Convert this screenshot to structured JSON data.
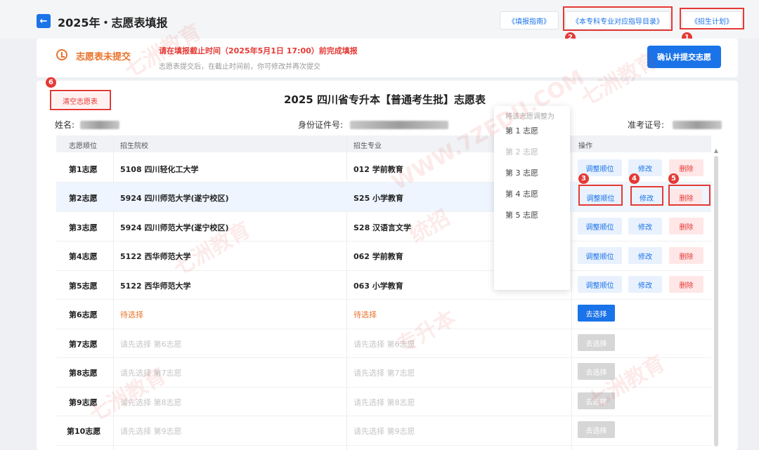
{
  "header": {
    "back_icon": "arrow-left-icon",
    "title": "2025年・志愿表填报",
    "links": [
      "《填报指南》",
      "《本专科专业对应指导目录》",
      "《招生计划》"
    ]
  },
  "notice": {
    "status_icon": "clock-icon",
    "status": "志愿表未提交",
    "deadline": "请在填报截止时间（2025年5月1日 17:00）前完成填报",
    "sub": "志愿表提交后，在截止时间前，你可修改并再次提交",
    "submit_label": "确认并提交志愿"
  },
  "panel": {
    "clear_label": "清空志愿表",
    "title": "2025 四川省专升本【普通考生批】志愿表",
    "name_label": "姓名:",
    "id_label": "身份证件号:",
    "ticket_label": "准考证号:"
  },
  "table": {
    "headers": [
      "志愿顺位",
      "招生院校",
      "招生专业",
      "操作"
    ],
    "rows": [
      {
        "rank": "第1志愿",
        "school": "5108 四川轻化工大学",
        "major": "012 学前教育"
      },
      {
        "rank": "第2志愿",
        "school": "5924 四川师范大学(遂宁校区)",
        "major": "S25 小学教育"
      },
      {
        "rank": "第3志愿",
        "school": "5924 四川师范大学(遂宁校区)",
        "major": "S28 汉语言文学"
      },
      {
        "rank": "第4志愿",
        "school": "5122 西华师范大学",
        "major": "062 学前教育"
      },
      {
        "rank": "第5志愿",
        "school": "5122 西华师范大学",
        "major": "063 小学教育"
      },
      {
        "rank": "第6志愿",
        "school": "待选择",
        "major": "待选择"
      },
      {
        "rank": "第7志愿",
        "school": "请先选择 第6志愿",
        "major": "请先选择 第6志愿"
      },
      {
        "rank": "第8志愿",
        "school": "请先选择 第7志愿",
        "major": "请先选择 第7志愿"
      },
      {
        "rank": "第9志愿",
        "school": "请先选择 第8志愿",
        "major": "请先选择 第8志愿"
      },
      {
        "rank": "第10志愿",
        "school": "请先选择 第9志愿",
        "major": "请先选择 第9志愿"
      }
    ],
    "actions": {
      "adjust": "调整顺位",
      "edit": "修改",
      "delete": "删除",
      "select": "去选择"
    }
  },
  "dropdown": {
    "title": "将该志愿调整为",
    "items": [
      "第 1 志愿",
      "第 2 志愿",
      "第 3 志愿",
      "第 4 志愿",
      "第 5 志愿"
    ]
  },
  "annotations": [
    "1",
    "2",
    "3",
    "4",
    "5",
    "6"
  ],
  "watermark": {
    "brand": "七洲教育",
    "tag1": "统招",
    "tag2": "专升本",
    "site": "WWW.7ZEDU.COM"
  },
  "colors": {
    "accent": "#1a73e8",
    "danger": "#e53935",
    "warning": "#e8742c"
  }
}
